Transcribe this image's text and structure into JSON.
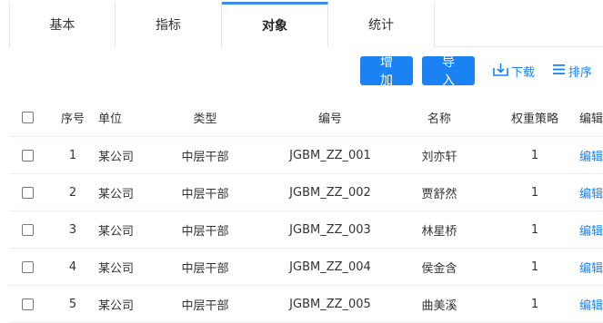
{
  "tabs": [
    {
      "label": "基本"
    },
    {
      "label": "指标"
    },
    {
      "label": "对象"
    },
    {
      "label": "统计"
    }
  ],
  "active_tab": 2,
  "toolbar": {
    "add_label": "增加",
    "import_label": "导入",
    "download_label": "下载",
    "sort_label": "排序"
  },
  "table": {
    "headers": {
      "no": "序号",
      "unit": "单位",
      "type": "类型",
      "code": "编号",
      "name": "名称",
      "weight": "权重策略",
      "edit": "编辑"
    },
    "rows": [
      {
        "no": "1",
        "unit": "某公司",
        "type": "中层干部",
        "code": "JGBM_ZZ_001",
        "name": "刘亦轩",
        "weight": "1",
        "edit": "编辑"
      },
      {
        "no": "2",
        "unit": "某公司",
        "type": "中层干部",
        "code": "JGBM_ZZ_002",
        "name": "贾舒然",
        "weight": "1",
        "edit": "编辑"
      },
      {
        "no": "3",
        "unit": "某公司",
        "type": "中层干部",
        "code": "JGBM_ZZ_003",
        "name": "林星桥",
        "weight": "1",
        "edit": "编辑"
      },
      {
        "no": "4",
        "unit": "某公司",
        "type": "中层干部",
        "code": "JGBM_ZZ_004",
        "name": "侯金含",
        "weight": "1",
        "edit": "编辑"
      },
      {
        "no": "5",
        "unit": "某公司",
        "type": "中层干部",
        "code": "JGBM_ZZ_005",
        "name": "曲美溪",
        "weight": "1",
        "edit": "编辑"
      }
    ]
  },
  "colors": {
    "accent": "#1a82f3",
    "tab_active_border": "#3a8ee6",
    "divider": "#ebeef5"
  }
}
